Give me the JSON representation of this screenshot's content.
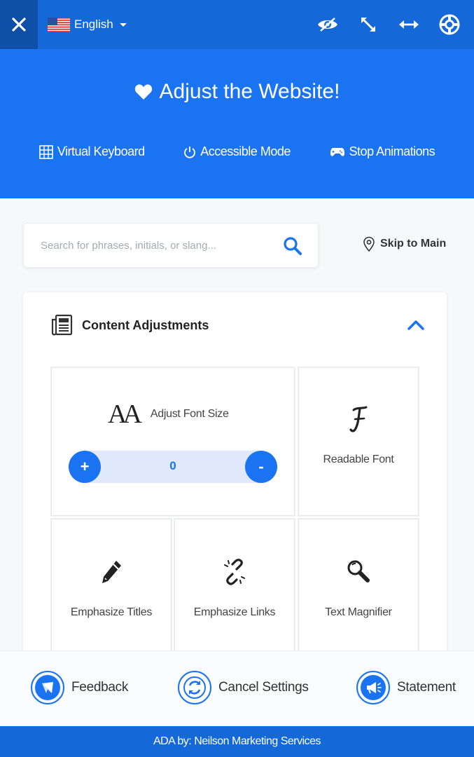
{
  "topbar": {
    "close_icon": "close-icon",
    "language": {
      "label": "English",
      "flag_icon": "us-flag-icon"
    },
    "icons": [
      "hide-interface-icon",
      "move-widget-icon",
      "oversize-widget-icon",
      "help-icon"
    ]
  },
  "hero": {
    "title": "Adjust the Website!",
    "actions": [
      {
        "label": "Virtual Keyboard",
        "icon": "keyboard-icon"
      },
      {
        "label": "Accessible Mode",
        "icon": "power-icon"
      },
      {
        "label": "Stop Animations",
        "icon": "gamepad-icon"
      }
    ]
  },
  "search": {
    "placeholder": "Search for phrases, initials, or slang...",
    "value": ""
  },
  "skip_to_main": "Skip to Main",
  "panel": {
    "title": "Content Adjustments",
    "font_size": {
      "label": "Adjust Font Size",
      "value": "0",
      "increase": "+",
      "decrease": "-"
    },
    "tiles": [
      {
        "label": "Readable Font",
        "icon": "readable-font-icon"
      },
      {
        "label": "Emphasize Titles",
        "icon": "pencil-icon"
      },
      {
        "label": "Emphasize Links",
        "icon": "broken-link-icon"
      },
      {
        "label": "Text Magnifier",
        "icon": "magnifier-icon"
      }
    ]
  },
  "footer": {
    "buttons": [
      {
        "label": "Feedback",
        "icon": "feedback-icon"
      },
      {
        "label": "Cancel Settings",
        "icon": "refresh-icon"
      },
      {
        "label": "Statement",
        "icon": "megaphone-icon"
      }
    ]
  },
  "credit": "ADA by: Neilson Marketing Services",
  "colors": {
    "primary": "#1a73f0",
    "topbar": "#1468d8",
    "close_bg": "#0e4fa8",
    "track": "#dfe9fb"
  }
}
